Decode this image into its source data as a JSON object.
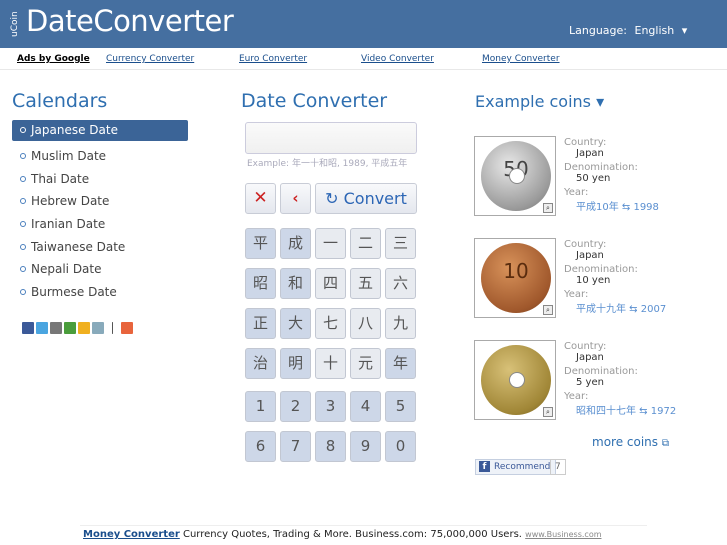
{
  "header": {
    "logo_small": "uCoin",
    "logo_main": "DateConverter",
    "language_label": "Language:",
    "language_value": "English",
    "dropdown_arrow": "▾"
  },
  "adbar": {
    "ads": "Ads by Google",
    "links": [
      "Currency Converter",
      "Euro Converter",
      "Video Converter",
      "Money Converter"
    ]
  },
  "calendars": {
    "title": "Calendars",
    "items": [
      "Japanese Date",
      "Muslim Date",
      "Thai Date",
      "Hebrew Date",
      "Iranian Date",
      "Taiwanese Date",
      "Nepali Date",
      "Burmese Date"
    ]
  },
  "converter": {
    "title": "Date Converter",
    "input_value": "",
    "example": "Example: 年一十和昭, 1989, 平成五年",
    "clear_glyph": "✕",
    "back_glyph": "‹",
    "convert_label": "Convert",
    "kanji_rows": [
      [
        "平",
        "成",
        "一",
        "二",
        "三"
      ],
      [
        "昭",
        "和",
        "四",
        "五",
        "六"
      ],
      [
        "正",
        "大",
        "七",
        "八",
        "九"
      ],
      [
        "治",
        "明",
        "十",
        "元",
        "年"
      ]
    ],
    "digit_rows": [
      [
        "1",
        "2",
        "3",
        "4",
        "5"
      ],
      [
        "6",
        "7",
        "8",
        "9",
        "0"
      ]
    ]
  },
  "coins": {
    "title": "Example coins",
    "title_arrow": "▾",
    "labels": {
      "country": "Country:",
      "denomination": "Denomination:",
      "year": "Year:"
    },
    "items": [
      {
        "face": "50",
        "country": "Japan",
        "denomination": "50 yen",
        "year_text": "平成10年 ⇆ 1998"
      },
      {
        "face": "10",
        "country": "Japan",
        "denomination": "10 yen",
        "year_text": "平成十九年 ⇆ 2007"
      },
      {
        "face": "",
        "country": "Japan",
        "denomination": "5 yen",
        "year_text": "昭和四十七年 ⇆ 1972"
      }
    ],
    "more": "more coins",
    "more_icon": "⧉",
    "recommend": "Recommend",
    "recommend_count": "7"
  },
  "bottom_ad": {
    "title": "Money Converter",
    "text": "Currency Quotes, Trading & More. Business.com: 75,000,000 Users.",
    "url": "www.Business.com"
  },
  "colors": {
    "header": "#456fa0",
    "accent": "#2f6fb0",
    "active": "#3b6497"
  }
}
